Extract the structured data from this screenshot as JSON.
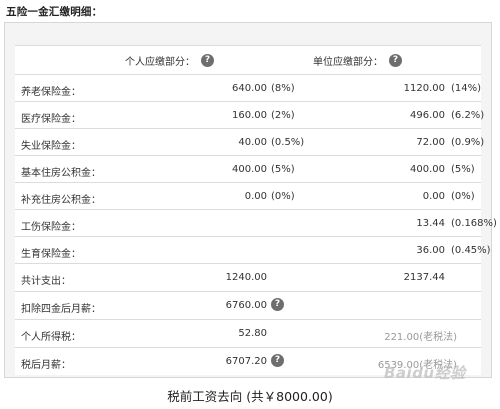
{
  "title": "五险一金汇缴明细：",
  "header": {
    "personal": "个人应缴部分：",
    "company": "单位应缴部分："
  },
  "rows": [
    {
      "label": "养老保险金：",
      "p_val": "640.00",
      "p_pct": "(8%)",
      "c_val": "1120.00",
      "c_pct": "(14%)"
    },
    {
      "label": "医疗保险金：",
      "p_val": "160.00",
      "p_pct": "(2%)",
      "c_val": "496.00",
      "c_pct": "(6.2%)"
    },
    {
      "label": "失业保险金：",
      "p_val": "40.00",
      "p_pct": "(0.5%)",
      "c_val": "72.00",
      "c_pct": "(0.9%)"
    },
    {
      "label": "基本住房公积金：",
      "p_val": "400.00",
      "p_pct": "(5%)",
      "c_val": "400.00",
      "c_pct": "(5%)"
    },
    {
      "label": "补充住房公积金：",
      "p_val": "0.00",
      "p_pct": "(0%)",
      "c_val": "0.00",
      "c_pct": "(0%)"
    },
    {
      "label": "工伤保险金：",
      "p_val": "",
      "p_pct": "",
      "c_val": "13.44",
      "c_pct": "(0.168%)"
    },
    {
      "label": "生育保险金：",
      "p_val": "",
      "p_pct": "",
      "c_val": "36.00",
      "c_pct": "(0.45%)"
    }
  ],
  "totals": {
    "label": "共计支出：",
    "p_val": "1240.00",
    "c_val": "2137.44"
  },
  "after_deduction": {
    "label": "扣除四金后月薪：",
    "value": "6760.00"
  },
  "tax": {
    "label": "个人所得税：",
    "value": "52.80",
    "old": "221.00(老税法)"
  },
  "net": {
    "label": "税后月薪：",
    "value": "6707.20",
    "old": "6539.00(老税法)"
  },
  "help_icon": "question-mark",
  "caption": "税前工资去向 (共￥8000.00)",
  "watermark": "Baidu经验"
}
